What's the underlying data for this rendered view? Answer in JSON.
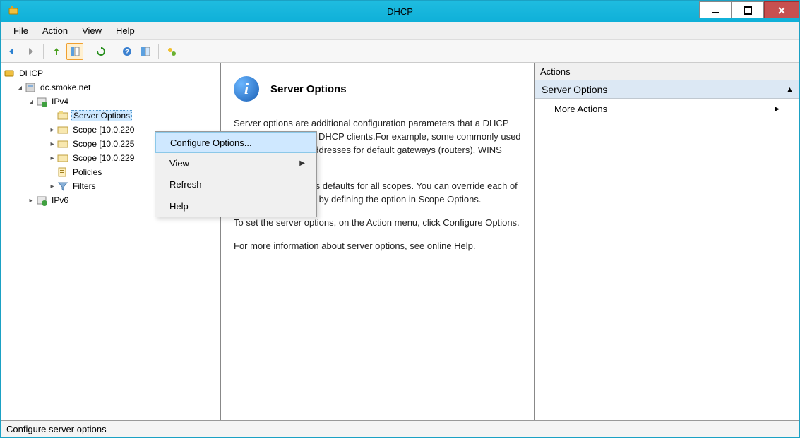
{
  "window": {
    "title": "DHCP"
  },
  "menubar": [
    "File",
    "Action",
    "View",
    "Help"
  ],
  "tree": {
    "root": "DHCP",
    "server": "dc.smoke.net",
    "ipv4": "IPv4",
    "ipv6": "IPv6",
    "server_options": "Server Options",
    "scope1": "Scope [10.0.220",
    "scope2": "Scope [10.0.225",
    "scope3": "Scope [10.0.229",
    "policies": "Policies",
    "filters": "Filters"
  },
  "context_menu": {
    "configure": "Configure Options...",
    "view": "View",
    "refresh": "Refresh",
    "help": "Help"
  },
  "main": {
    "title": "Server Options",
    "p1": "Server options are additional configuration parameters that a DHCP server can assign to DHCP clients.For example, some commonly used options include IP addresses for default gateways (routers), WINS servers,",
    "p2": "Server options act as defaults for all scopes.  You can override each of these server options by defining the option in Scope Options.",
    "p3": "To set the server options, on the Action menu, click Configure Options.",
    "p4": "For more information about server options, see online Help."
  },
  "actions": {
    "header": "Actions",
    "section": "Server Options",
    "more": "More Actions"
  },
  "statusbar": "Configure server options"
}
